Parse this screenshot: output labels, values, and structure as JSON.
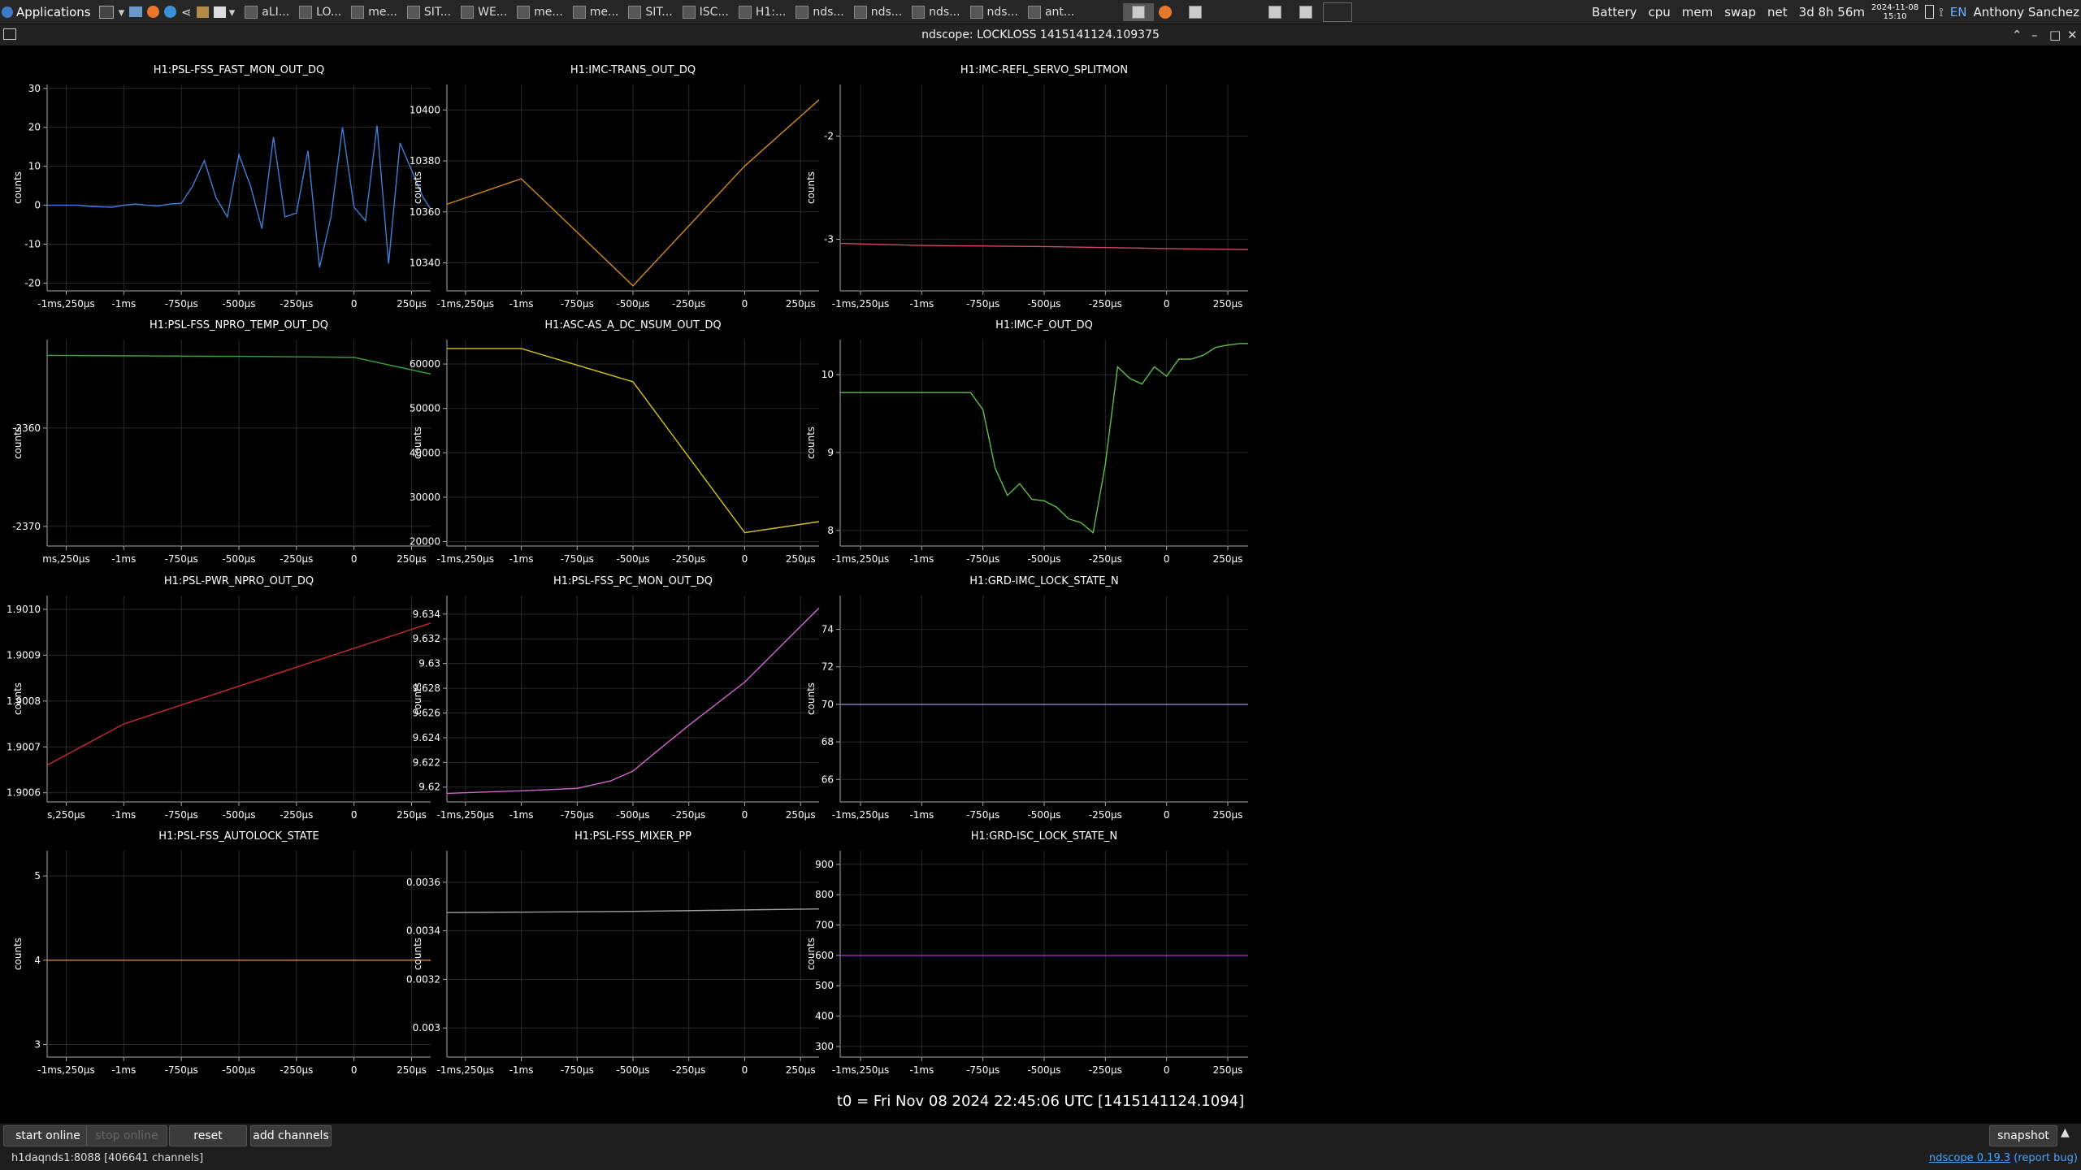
{
  "taskbar": {
    "apps_label": "Applications",
    "tasks": [
      "aLI...",
      "LO...",
      "me...",
      "SIT...",
      "WE...",
      "me...",
      "me...",
      "SIT...",
      "ISC...",
      "H1:...",
      "nds...",
      "nds...",
      "nds...",
      "nds...",
      "ant..."
    ],
    "tray": {
      "battery": "Battery",
      "cpu": "cpu",
      "mem": "mem",
      "swap": "swap",
      "net": "net",
      "uptime": "3d 8h 56m",
      "date": "2024-11-08",
      "time": "15:10",
      "lang": "EN",
      "user": "Anthony Sanchez"
    }
  },
  "window": {
    "title": "ndscope: LOCKLOSS 1415141124.109375"
  },
  "plots": [
    {
      "title": "H1:PSL-FSS_FAST_MON_OUT_DQ",
      "ylabel": "counts",
      "color": "#3f7fd6",
      "yticks": [
        "30",
        "20",
        "10",
        "0",
        "-10",
        "-20"
      ],
      "xticks": [
        "-1ms,250µs",
        "-1ms",
        "-750µs",
        "-500µs",
        "-250µs",
        "0",
        "250µs"
      ],
      "ylim": [
        -22,
        31
      ],
      "xlim": [
        -1.333,
        0.333
      ],
      "x": [
        -1.333,
        -1.25,
        -1.2,
        -1.15,
        -1.05,
        -1.0,
        -0.95,
        -0.9,
        -0.85,
        -0.8,
        -0.75,
        -0.7,
        -0.65,
        -0.6,
        -0.55,
        -0.5,
        -0.45,
        -0.4,
        -0.35,
        -0.3,
        -0.25,
        -0.2,
        -0.15,
        -0.1,
        -0.05,
        0.0,
        0.05,
        0.1,
        0.15,
        0.2,
        0.25,
        0.3,
        0.333
      ],
      "y": [
        0,
        0,
        0,
        -0.3,
        -0.5,
        0,
        0.3,
        0,
        -0.2,
        0.3,
        0.5,
        5,
        11.5,
        2,
        -3,
        13,
        5,
        -6,
        17.5,
        -3,
        -2,
        14,
        -16,
        -3,
        20,
        -0.5,
        -4,
        20.5,
        -15,
        16,
        9,
        2,
        -1
      ]
    },
    {
      "title": "H1:IMC-TRANS_OUT_DQ",
      "ylabel": "counts",
      "color": "#d28a1e",
      "yticks": [
        "10400",
        "10380",
        "10360",
        "10340"
      ],
      "xticks": [
        "-1ms,250µs",
        "-1ms",
        "-750µs",
        "-500µs",
        "-250µs",
        "0",
        "250µs"
      ],
      "ylim": [
        10329,
        10410
      ],
      "xlim": [
        -1.333,
        0.333
      ],
      "x": [
        -1.333,
        -1.0,
        -0.5,
        0.0,
        0.333
      ],
      "y": [
        10363,
        10373,
        10331,
        10378,
        10404
      ]
    },
    {
      "title": "H1:IMC-REFL_SERVO_SPLITMON",
      "ylabel": "counts",
      "color": "#d0486a",
      "yticks": [
        "-2",
        "-3"
      ],
      "xticks": [
        "-1ms,250µs",
        "-1ms",
        "-750µs",
        "-500µs",
        "-250µs",
        "0",
        "250µs"
      ],
      "ylim": [
        -3.5,
        -1.5
      ],
      "xlim": [
        -1.333,
        0.333
      ],
      "x": [
        -1.333,
        -1.0,
        -0.5,
        0.0,
        0.333
      ],
      "y": [
        -3.04,
        -3.06,
        -3.07,
        -3.09,
        -3.1
      ]
    },
    {
      "title": "H1:PSL-FSS_NPRO_TEMP_OUT_DQ",
      "ylabel": "counts",
      "color": "#3aa23a",
      "yticks": [
        "-2360",
        "-2370"
      ],
      "xticks": [
        "ms,250µs",
        "-1ms",
        "-750µs",
        "-500µs",
        "-250µs",
        "0",
        "250µs"
      ],
      "ylim": [
        -2372,
        -2351
      ],
      "xlim": [
        -1.333,
        0.333
      ],
      "x": [
        -1.333,
        -0.5,
        0.0,
        0.333
      ],
      "y": [
        -2352.6,
        -2352.7,
        -2352.8,
        -2354.5
      ]
    },
    {
      "title": "H1:ASC-AS_A_DC_NSUM_OUT_DQ",
      "ylabel": "counts",
      "color": "#d4c21e",
      "yticks": [
        "60000",
        "50000",
        "40000",
        "30000",
        "20000"
      ],
      "xticks": [
        "-1ms,250µs",
        "-1ms",
        "-750µs",
        "-500µs",
        "-250µs",
        "0",
        "250µs"
      ],
      "ylim": [
        19000,
        65500
      ],
      "xlim": [
        -1.333,
        0.333
      ],
      "x": [
        -1.333,
        -1.0,
        -0.5,
        0.0,
        0.333
      ],
      "y": [
        63500,
        63500,
        56000,
        22000,
        24500
      ]
    },
    {
      "title": "H1:IMC-F_OUT_DQ",
      "ylabel": "counts",
      "color": "#5fbf48",
      "yticks": [
        "10",
        "9",
        "8"
      ],
      "xticks": [
        "-1ms,250µs",
        "-1ms",
        "-750µs",
        "-500µs",
        "-250µs",
        "0",
        "250µs"
      ],
      "ylim": [
        7.8,
        10.45
      ],
      "xlim": [
        -1.333,
        0.333
      ],
      "x": [
        -1.333,
        -0.8,
        -0.75,
        -0.7,
        -0.65,
        -0.6,
        -0.55,
        -0.5,
        -0.45,
        -0.4,
        -0.35,
        -0.3,
        -0.25,
        -0.2,
        -0.15,
        -0.1,
        -0.05,
        0.0,
        0.05,
        0.1,
        0.15,
        0.2,
        0.25,
        0.3,
        0.333
      ],
      "y": [
        9.77,
        9.77,
        9.55,
        8.8,
        8.45,
        8.6,
        8.4,
        8.38,
        8.3,
        8.15,
        8.1,
        7.97,
        8.85,
        10.1,
        9.95,
        9.88,
        10.1,
        9.98,
        10.2,
        10.2,
        10.25,
        10.35,
        10.38,
        10.4,
        10.4
      ]
    },
    {
      "title": "H1:PSL-PWR_NPRO_OUT_DQ",
      "ylabel": "counts",
      "color": "#cc2a2a",
      "yticks": [
        "1.9010",
        "1.9009",
        "1.9008",
        "1.9007",
        "1.9006"
      ],
      "xticks": [
        "s,250µs",
        "-1ms",
        "-750µs",
        "-500µs",
        "-250µs",
        "0",
        "250µs"
      ],
      "ylim": [
        1.90058,
        1.90103
      ],
      "xlim": [
        -1.333,
        0.333
      ],
      "x": [
        -1.333,
        -1.0,
        0.333
      ],
      "y": [
        1.90066,
        1.90075,
        1.90097
      ]
    },
    {
      "title": "H1:PSL-FSS_PC_MON_OUT_DQ",
      "ylabel": "counts",
      "color": "#d266d2",
      "yticks": [
        "9.634",
        "9.632",
        "9.63",
        "9.628",
        "9.626",
        "9.624",
        "9.622",
        "9.62"
      ],
      "xticks": [
        "-1ms,250µs",
        "-1ms",
        "-750µs",
        "-500µs",
        "-250µs",
        "0",
        "250µs"
      ],
      "ylim": [
        9.6188,
        9.6355
      ],
      "xlim": [
        -1.333,
        0.333
      ],
      "x": [
        -1.333,
        -1.0,
        -0.75,
        -0.6,
        -0.5,
        -0.4,
        -0.25,
        0.0,
        0.333
      ],
      "y": [
        9.6195,
        9.6197,
        9.6199,
        9.6205,
        9.6213,
        9.6228,
        9.625,
        9.6285,
        9.6345
      ]
    },
    {
      "title": "H1:GRD-IMC_LOCK_STATE_N",
      "ylabel": "counts",
      "color": "#8a8ac0",
      "yticks": [
        "74",
        "72",
        "70",
        "68",
        "66"
      ],
      "xticks": [
        "-1ms,250µs",
        "-1ms",
        "-750µs",
        "-500µs",
        "-250µs",
        "0",
        "250µs"
      ],
      "ylim": [
        64.8,
        75.8
      ],
      "xlim": [
        -1.333,
        0.333
      ],
      "x": [
        -1.333,
        0.333
      ],
      "y": [
        70,
        70
      ]
    },
    {
      "title": "H1:PSL-FSS_AUTOLOCK_STATE",
      "ylabel": "counts",
      "color": "#d2872a",
      "yticks": [
        "5",
        "4",
        "3"
      ],
      "xticks": [
        "-1ms,250µs",
        "-1ms",
        "-750µs",
        "-500µs",
        "-250µs",
        "0",
        "250µs"
      ],
      "ylim": [
        2.85,
        5.3
      ],
      "xlim": [
        -1.333,
        0.333
      ],
      "x": [
        -1.333,
        0.333
      ],
      "y": [
        4,
        4
      ]
    },
    {
      "title": "H1:PSL-FSS_MIXER_PP",
      "ylabel": "counts",
      "color": "#a0a0a0",
      "yticks": [
        "0.0036",
        "0.0034",
        "0.0032",
        "0.003"
      ],
      "xticks": [
        "-1ms,250µs",
        "-1ms",
        "-750µs",
        "-500µs",
        "-250µs",
        "0",
        "250µs"
      ],
      "ylim": [
        0.00288,
        0.00373
      ],
      "xlim": [
        -1.333,
        0.333
      ],
      "x": [
        -1.333,
        -0.5,
        0.333
      ],
      "y": [
        0.003475,
        0.00348,
        0.00349
      ]
    },
    {
      "title": "H1:GRD-ISC_LOCK_STATE_N",
      "ylabel": "counts",
      "color": "#9a2ae0",
      "yticks": [
        "900",
        "800",
        "700",
        "600",
        "500",
        "400",
        "300"
      ],
      "xticks": [
        "-1ms,250µs",
        "-1ms",
        "-750µs",
        "-500µs",
        "-250µs",
        "0",
        "250µs"
      ],
      "ylim": [
        265,
        945
      ],
      "xlim": [
        -1.333,
        0.333
      ],
      "x": [
        -1.333,
        0.333
      ],
      "y": [
        600,
        600
      ]
    }
  ],
  "t0_label": "t0 = Fri Nov 08 2024 22:45:06 UTC [1415141124.1094]",
  "buttons": {
    "start_online": "start online",
    "stop_online": "stop online",
    "reset": "reset",
    "add_channels": "add channels",
    "snapshot": "snapshot"
  },
  "status": {
    "server": "h1daqnds1:8088  [406641 channels]",
    "version_link": "ndscope 0.19.3",
    "report_bug": "(report bug)"
  }
}
